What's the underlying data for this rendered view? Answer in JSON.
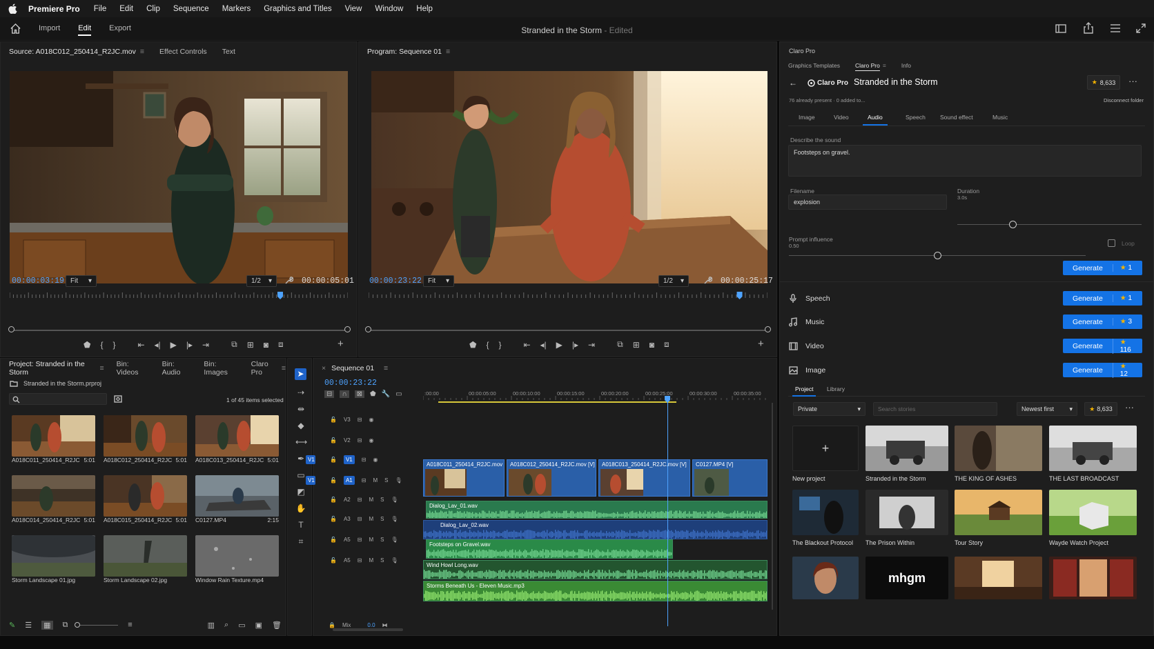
{
  "menubar": {
    "app_name": "Premiere Pro",
    "items": [
      "File",
      "Edit",
      "Clip",
      "Sequence",
      "Markers",
      "Graphics and Titles",
      "View",
      "Window",
      "Help"
    ]
  },
  "header": {
    "nav": [
      "Import",
      "Edit",
      "Export"
    ],
    "active_nav": "Edit",
    "title": "Stranded in the Storm",
    "title_status": " - Edited"
  },
  "source_monitor": {
    "tabs": [
      "Source: A018C012_250414_R2JC.mov",
      "Effect Controls",
      "Text"
    ],
    "timecode": "00:00:03:19",
    "zoom": "Fit",
    "resolution": "1/2",
    "duration": "00:00:05:01",
    "playhead_fraction": 0.8
  },
  "program_monitor": {
    "tab": "Program: Sequence 01",
    "timecode": "00:00:23:22",
    "zoom": "Fit",
    "resolution": "1/2",
    "duration": "00:00:25:17",
    "playhead_fraction": 0.93
  },
  "project": {
    "tabs": [
      "Project: Stranded in the Storm",
      "Bin: Videos",
      "Bin: Audio",
      "Bin: Images",
      "Claro Pro"
    ],
    "file": "Stranded in the Storm.prproj",
    "selection": "1 of 45 items selected",
    "clips": [
      {
        "name": "A018C011_250414_R2JC",
        "dur": "5:01"
      },
      {
        "name": "A018C012_250414_R2JC",
        "dur": "5:01"
      },
      {
        "name": "A018C013_250414_R2JC",
        "dur": "5:01"
      },
      {
        "name": "A018C014_250414_R2JC",
        "dur": "5:01"
      },
      {
        "name": "A018C015_250414_R2JC",
        "dur": "5:01"
      },
      {
        "name": "C0127.MP4",
        "dur": "2:15"
      },
      {
        "name": "Storm Landscape 01.jpg",
        "dur": ""
      },
      {
        "name": "Storm Landscape 02.jpg",
        "dur": ""
      },
      {
        "name": "Window Rain Texture.mp4",
        "dur": ""
      }
    ]
  },
  "timeline": {
    "tab": "Sequence 01",
    "timecode": "00:00:23:22",
    "ruler": [
      ":00:00",
      "00:00:05:00",
      "00:00:10:00",
      "00:00:15:00",
      "00:00:20:00",
      "00:00:25:00",
      "00:00:30:00",
      "00:00:35:00"
    ],
    "tracks": [
      "V3",
      "V2",
      "V1",
      "A1",
      "A2",
      "A3",
      "A5",
      "A5"
    ],
    "mix_label": "Mix",
    "mix_value": "0.0",
    "video_clips": [
      "A018C011_250414_R2JC.mov [V]",
      "A018C012_250414_R2JC.mov [V]",
      "A018C013_250414_R2JC.mov [V]",
      "C0127.MP4 [V]"
    ],
    "audio_clips": [
      "Dialog_Lav_01.wav",
      "Dialog_Lav_02.wav",
      "Footsteps on Gravel.wav",
      "Wind Howl Long.wav",
      "Storms Beneath Us - Eleven Music.mp3"
    ]
  },
  "claro": {
    "panel_title": "Claro Pro",
    "tabs": [
      "Graphics Templates",
      "Claro Pro",
      "Info"
    ],
    "brand": "Claro Pro",
    "project_title": "Stranded in the Storm",
    "credits": "8,633",
    "status": "76 already present · 0 added to...",
    "disconnect": "Disconnect folder",
    "media_tabs": [
      "Image",
      "Video",
      "Audio",
      "Speech",
      "Sound effect",
      "Music"
    ],
    "active_media_tab": "Audio",
    "describe_label": "Describe the sound",
    "describe_value": "Footsteps on gravel.",
    "filename_label": "Filename",
    "filename_value": "explosion",
    "duration_label": "Duration",
    "duration_value": "3.0s",
    "prompt_label": "Prompt influence",
    "prompt_value": "0.50",
    "loop_label": "Loop",
    "generate_label": "Generate",
    "gen_rows": [
      {
        "label": "Speech",
        "icon": "microphone-icon",
        "count": "1"
      },
      {
        "label": "Music",
        "icon": "music-note-icon",
        "count": "3"
      },
      {
        "label": "Video",
        "icon": "film-icon",
        "count": "116"
      },
      {
        "label": "Image",
        "icon": "image-icon",
        "count": "12"
      }
    ],
    "sfx_count": "1",
    "library_tabs": [
      "Project",
      "Library"
    ],
    "visibility": "Private",
    "search_placeholder": "Search stories",
    "sort": "Newest first",
    "library_credits": "8,633",
    "stories": [
      {
        "title": "New project"
      },
      {
        "title": "Stranded in the Storm"
      },
      {
        "title": "THE KING OF ASHES"
      },
      {
        "title": "THE LAST BROADCAST"
      },
      {
        "title": "The Blackout Protocol"
      },
      {
        "title": "The Prison Within"
      },
      {
        "title": "Tour Story"
      },
      {
        "title": "Wayde Watch Project"
      },
      {
        "title": ""
      },
      {
        "title": "mhgm"
      },
      {
        "title": ""
      },
      {
        "title": ""
      }
    ]
  }
}
